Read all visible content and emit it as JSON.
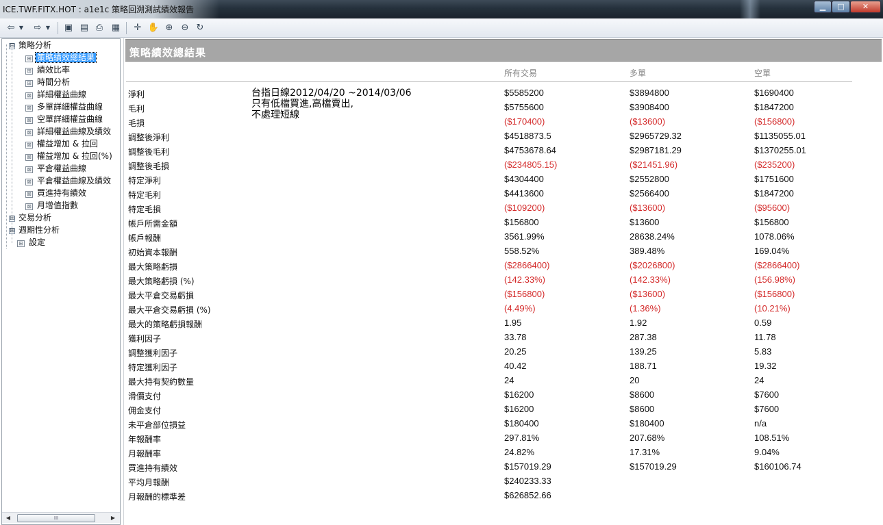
{
  "window": {
    "title": "ICE.TWF.FITX.HOT : a1e1c 策略回溯測試績效報告",
    "minimize_glyph": "▁",
    "maximize_glyph": "□",
    "close_glyph": "✕"
  },
  "toolbar": {
    "buttons": [
      "back-icon",
      "back-dropdown-icon",
      "forward-icon",
      "forward-dropdown-icon",
      "save-icon",
      "preview-icon",
      "print-icon",
      "layout-icon",
      "crosshair-icon",
      "hand-icon",
      "zoom-in-icon",
      "zoom-out-icon",
      "reset-view-icon"
    ]
  },
  "tree": {
    "items": [
      {
        "label": "策略分析",
        "expander": "⊟"
      },
      {
        "label": "策略績效總結果",
        "selected": true
      },
      {
        "label": "績效比率"
      },
      {
        "label": "時間分析"
      },
      {
        "label": "詳細權益曲線"
      },
      {
        "label": "多單詳細權益曲線"
      },
      {
        "label": "空單詳細權益曲線"
      },
      {
        "label": "詳細權益曲線及績效"
      },
      {
        "label": "權益增加 & 拉回"
      },
      {
        "label": "權益增加 & 拉回(%)"
      },
      {
        "label": "平倉權益曲線"
      },
      {
        "label": "平倉權益曲線及績效"
      },
      {
        "label": "買進持有績效"
      },
      {
        "label": "月增值指數"
      },
      {
        "label": "交易分析",
        "expander": "⊞"
      },
      {
        "label": "週期性分析",
        "expander": "⊞"
      },
      {
        "label": "設定"
      }
    ],
    "scroll_left": "◀",
    "scroll_right": "▶",
    "scroll_grip": "III"
  },
  "report": {
    "title": "策略績效總結果",
    "columns": [
      "所有交易",
      "多單",
      "空單"
    ],
    "note_lines": [
      "台指日線2012/04/20 ~2014/03/06",
      "只有低檔買進,高檔賣出,",
      "不處理短線"
    ],
    "rows": [
      {
        "label": "淨利",
        "all": "$5585200",
        "long": "$3894800",
        "short": "$1690400"
      },
      {
        "label": "毛利",
        "all": "$5755600",
        "long": "$3908400",
        "short": "$1847200"
      },
      {
        "label": "毛損",
        "all": "($170400)",
        "long": "($13600)",
        "short": "($156800)"
      },
      {
        "label": "調整後淨利",
        "all": "$4518873.5",
        "long": "$2965729.32",
        "short": "$1135055.01"
      },
      {
        "label": "調整後毛利",
        "all": "$4753678.64",
        "long": "$2987181.29",
        "short": "$1370255.01"
      },
      {
        "label": "調整後毛損",
        "all": "($234805.15)",
        "long": "($21451.96)",
        "short": "($235200)"
      },
      {
        "label": "特定淨利",
        "all": "$4304400",
        "long": "$2552800",
        "short": "$1751600"
      },
      {
        "label": "特定毛利",
        "all": "$4413600",
        "long": "$2566400",
        "short": "$1847200"
      },
      {
        "label": "特定毛損",
        "all": "($109200)",
        "long": "($13600)",
        "short": "($95600)"
      },
      {
        "label": "帳戶所需金額",
        "all": "$156800",
        "long": "$13600",
        "short": "$156800"
      },
      {
        "label": "帳戶報酬",
        "all": "3561.99%",
        "long": "28638.24%",
        "short": "1078.06%"
      },
      {
        "label": "初始資本報酬",
        "all": "558.52%",
        "long": "389.48%",
        "short": "169.04%"
      },
      {
        "label": "最大策略虧損",
        "all": "($2866400)",
        "long": "($2026800)",
        "short": "($2866400)"
      },
      {
        "label": "最大策略虧損 (%)",
        "all": "(142.33%)",
        "long": "(142.33%)",
        "short": "(156.98%)"
      },
      {
        "label": "最大平倉交易虧損",
        "all": "($156800)",
        "long": "($13600)",
        "short": "($156800)"
      },
      {
        "label": "最大平倉交易虧損 (%)",
        "all": "(4.49%)",
        "long": "(1.36%)",
        "short": "(10.21%)"
      },
      {
        "label": "最大的策略虧損報酬",
        "all": "1.95",
        "long": "1.92",
        "short": "0.59"
      },
      {
        "label": "獲利因子",
        "all": "33.78",
        "long": "287.38",
        "short": "11.78"
      },
      {
        "label": "調整獲利因子",
        "all": "20.25",
        "long": "139.25",
        "short": "5.83"
      },
      {
        "label": "特定獲利因子",
        "all": "40.42",
        "long": "188.71",
        "short": "19.32"
      },
      {
        "label": "最大持有契約數量",
        "all": "24",
        "long": "20",
        "short": "24"
      },
      {
        "label": "滑價支付",
        "all": "$16200",
        "long": "$8600",
        "short": "$7600"
      },
      {
        "label": "佣金支付",
        "all": "$16200",
        "long": "$8600",
        "short": "$7600"
      },
      {
        "label": "未平倉部位損益",
        "all": "$180400",
        "long": "$180400",
        "short": "n/a"
      },
      {
        "label": "年報酬率",
        "all": "297.81%",
        "long": "207.68%",
        "short": "108.51%"
      },
      {
        "label": "月報酬率",
        "all": "24.82%",
        "long": "17.31%",
        "short": "9.04%"
      },
      {
        "label": "買進持有績效",
        "all": "$157019.29",
        "long": "$157019.29",
        "short": "$160106.74"
      },
      {
        "label": "平均月報酬",
        "all": "$240233.33",
        "long": "",
        "short": ""
      },
      {
        "label": "月報酬的標準差",
        "all": "$626852.66",
        "long": "",
        "short": ""
      }
    ]
  }
}
